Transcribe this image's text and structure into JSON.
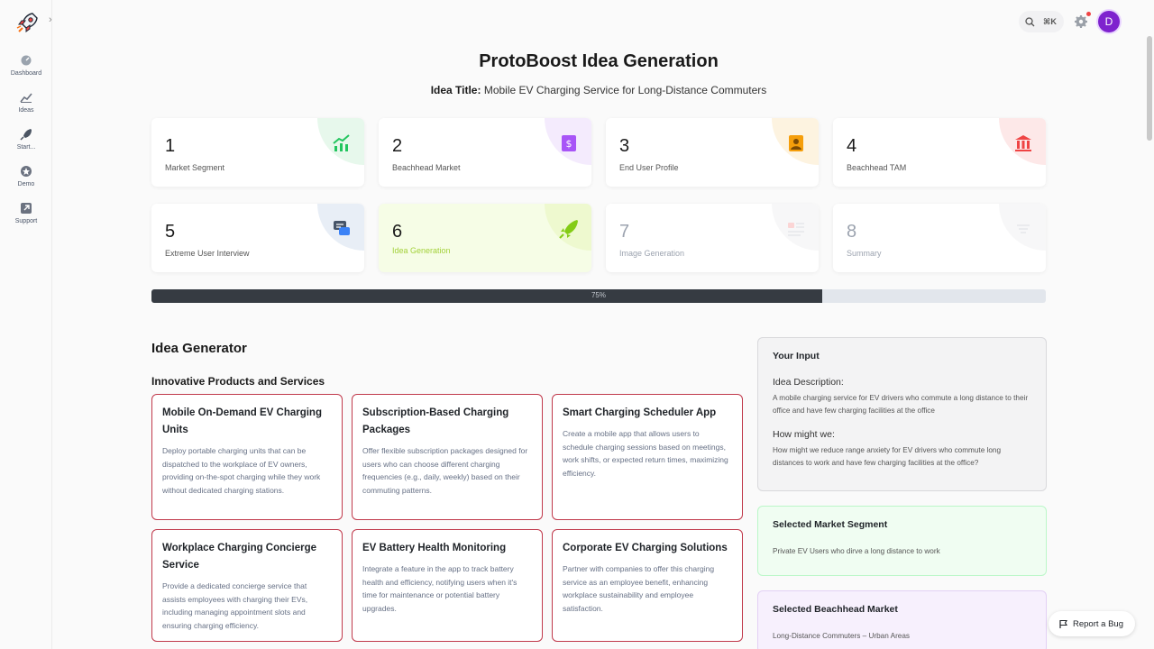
{
  "sidebar": {
    "items": [
      {
        "label": "Dashboard",
        "icon": "dashboard-icon"
      },
      {
        "label": "Ideas",
        "icon": "chart-icon"
      },
      {
        "label": "Start...",
        "icon": "rocket-icon"
      },
      {
        "label": "Demo",
        "icon": "star-icon"
      },
      {
        "label": "Support",
        "icon": "external-link-icon"
      }
    ]
  },
  "header": {
    "search_shortcut": "⌘K",
    "avatar_initial": "D"
  },
  "page": {
    "title": "ProtoBoost Idea Generation",
    "idea_title_label": "Idea Title:",
    "idea_title_value": "Mobile EV Charging Service for Long-Distance Commuters"
  },
  "steps": [
    {
      "number": "1",
      "label": "Market Segment",
      "icon": "trending-up-icon",
      "color": "#22c55e"
    },
    {
      "number": "2",
      "label": "Beachhead Market",
      "icon": "dollar-icon",
      "color": "#a855f7"
    },
    {
      "number": "3",
      "label": "End User Profile",
      "icon": "user-icon",
      "color": "#f59e0b"
    },
    {
      "number": "4",
      "label": "Beachhead TAM",
      "icon": "bank-icon",
      "color": "#ef4444"
    },
    {
      "number": "5",
      "label": "Extreme User Interview",
      "icon": "chat-icon",
      "color": "#3b82f6"
    },
    {
      "number": "6",
      "label": "Idea Generation",
      "icon": "rocket-icon",
      "color": "#84cc16"
    },
    {
      "number": "7",
      "label": "Image Generation",
      "icon": "image-icon",
      "color": "#e5e7eb"
    },
    {
      "number": "8",
      "label": "Summary",
      "icon": "list-icon",
      "color": "#e5e7eb"
    }
  ],
  "progress": {
    "percent": 75,
    "label": "75%"
  },
  "generator": {
    "title": "Idea Generator",
    "section_title": "Innovative Products and Services",
    "ideas": [
      {
        "title": "Mobile On-Demand EV Charging Units",
        "description": "Deploy portable charging units that can be dispatched to the workplace of EV owners, providing on-the-spot charging while they work without dedicated charging stations."
      },
      {
        "title": "Subscription-Based Charging Packages",
        "description": "Offer flexible subscription packages designed for users who can choose different charging frequencies (e.g., daily, weekly) based on their commuting patterns."
      },
      {
        "title": "Smart Charging Scheduler App",
        "description": "Create a mobile app that allows users to schedule charging sessions based on meetings, work shifts, or expected return times, maximizing efficiency."
      },
      {
        "title": "Workplace Charging Concierge Service",
        "description": "Provide a dedicated concierge service that assists employees with charging their EVs, including managing appointment slots and ensuring charging efficiency."
      },
      {
        "title": "EV Battery Health Monitoring",
        "description": "Integrate a feature in the app to track battery health and efficiency, notifying users when it's time for maintenance or potential battery upgrades."
      },
      {
        "title": "Corporate EV Charging Solutions",
        "description": "Partner with companies to offer this charging service as an employee benefit, enhancing workplace sustainability and employee satisfaction."
      }
    ]
  },
  "your_input": {
    "title": "Your Input",
    "description_label": "Idea Description:",
    "description": "A mobile charging service for EV drivers who commute a long distance to their office and have few charging facilities at the office",
    "hmw_label": "How might we:",
    "hmw": "How might we reduce range anxiety for EV drivers who commute long distances to work and have few charging facilities at the office?"
  },
  "selected_market": {
    "title": "Selected Market Segment",
    "value": "Private EV Users who dirve a long distance to work"
  },
  "selected_beachhead": {
    "title": "Selected Beachhead Market",
    "value": "Long-Distance Commuters – Urban Areas"
  },
  "report_bug": {
    "label": "Report a Bug"
  }
}
